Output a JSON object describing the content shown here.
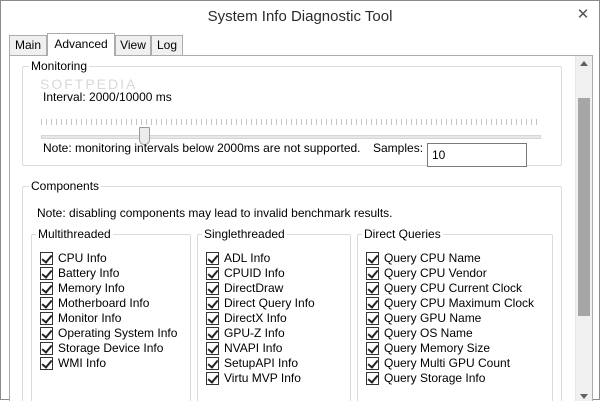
{
  "window": {
    "title": "System Info Diagnostic Tool",
    "close_glyph": "✕"
  },
  "tabs": [
    {
      "label": "Main"
    },
    {
      "label": "Advanced"
    },
    {
      "label": "View"
    },
    {
      "label": "Log"
    }
  ],
  "monitoring": {
    "group_label": "Monitoring",
    "interval_label": "Interval: 2000/10000 ms",
    "interval_value_ms": 2000,
    "interval_max_ms": 10000,
    "note": "Note: monitoring intervals below 2000ms are not supported.",
    "samples_label": "Samples:",
    "samples_value": "10"
  },
  "components": {
    "group_label": "Components",
    "note": "Note: disabling components may lead to invalid benchmark results.",
    "multithreaded": {
      "label": "Multithreaded",
      "items": [
        {
          "label": "CPU Info",
          "checked": true
        },
        {
          "label": "Battery Info",
          "checked": true
        },
        {
          "label": "Memory Info",
          "checked": true
        },
        {
          "label": "Motherboard Info",
          "checked": true
        },
        {
          "label": "Monitor Info",
          "checked": true
        },
        {
          "label": "Operating System Info",
          "checked": true
        },
        {
          "label": "Storage Device Info",
          "checked": true
        },
        {
          "label": "WMI Info",
          "checked": true
        }
      ]
    },
    "singlethreaded": {
      "label": "Singlethreaded",
      "items": [
        {
          "label": "ADL Info",
          "checked": true
        },
        {
          "label": "CPUID Info",
          "checked": true
        },
        {
          "label": "DirectDraw",
          "checked": true
        },
        {
          "label": "Direct Query Info",
          "checked": true
        },
        {
          "label": "DirectX Info",
          "checked": true
        },
        {
          "label": "GPU-Z Info",
          "checked": true
        },
        {
          "label": "NVAPI Info",
          "checked": true
        },
        {
          "label": "SetupAPI Info",
          "checked": true
        },
        {
          "label": "Virtu MVP Info",
          "checked": true
        }
      ]
    },
    "direct_queries": {
      "label": "Direct Queries",
      "items": [
        {
          "label": "Query CPU Name",
          "checked": true
        },
        {
          "label": "Query CPU Vendor",
          "checked": true
        },
        {
          "label": "Query CPU Current Clock",
          "checked": true
        },
        {
          "label": "Query CPU Maximum Clock",
          "checked": true
        },
        {
          "label": "Query GPU Name",
          "checked": true
        },
        {
          "label": "Query OS Name",
          "checked": true
        },
        {
          "label": "Query Memory Size",
          "checked": true
        },
        {
          "label": "Query Multi GPU Count",
          "checked": true
        },
        {
          "label": "Query Storage Info",
          "checked": true
        }
      ]
    }
  },
  "watermark": "SOFTPEDIA"
}
